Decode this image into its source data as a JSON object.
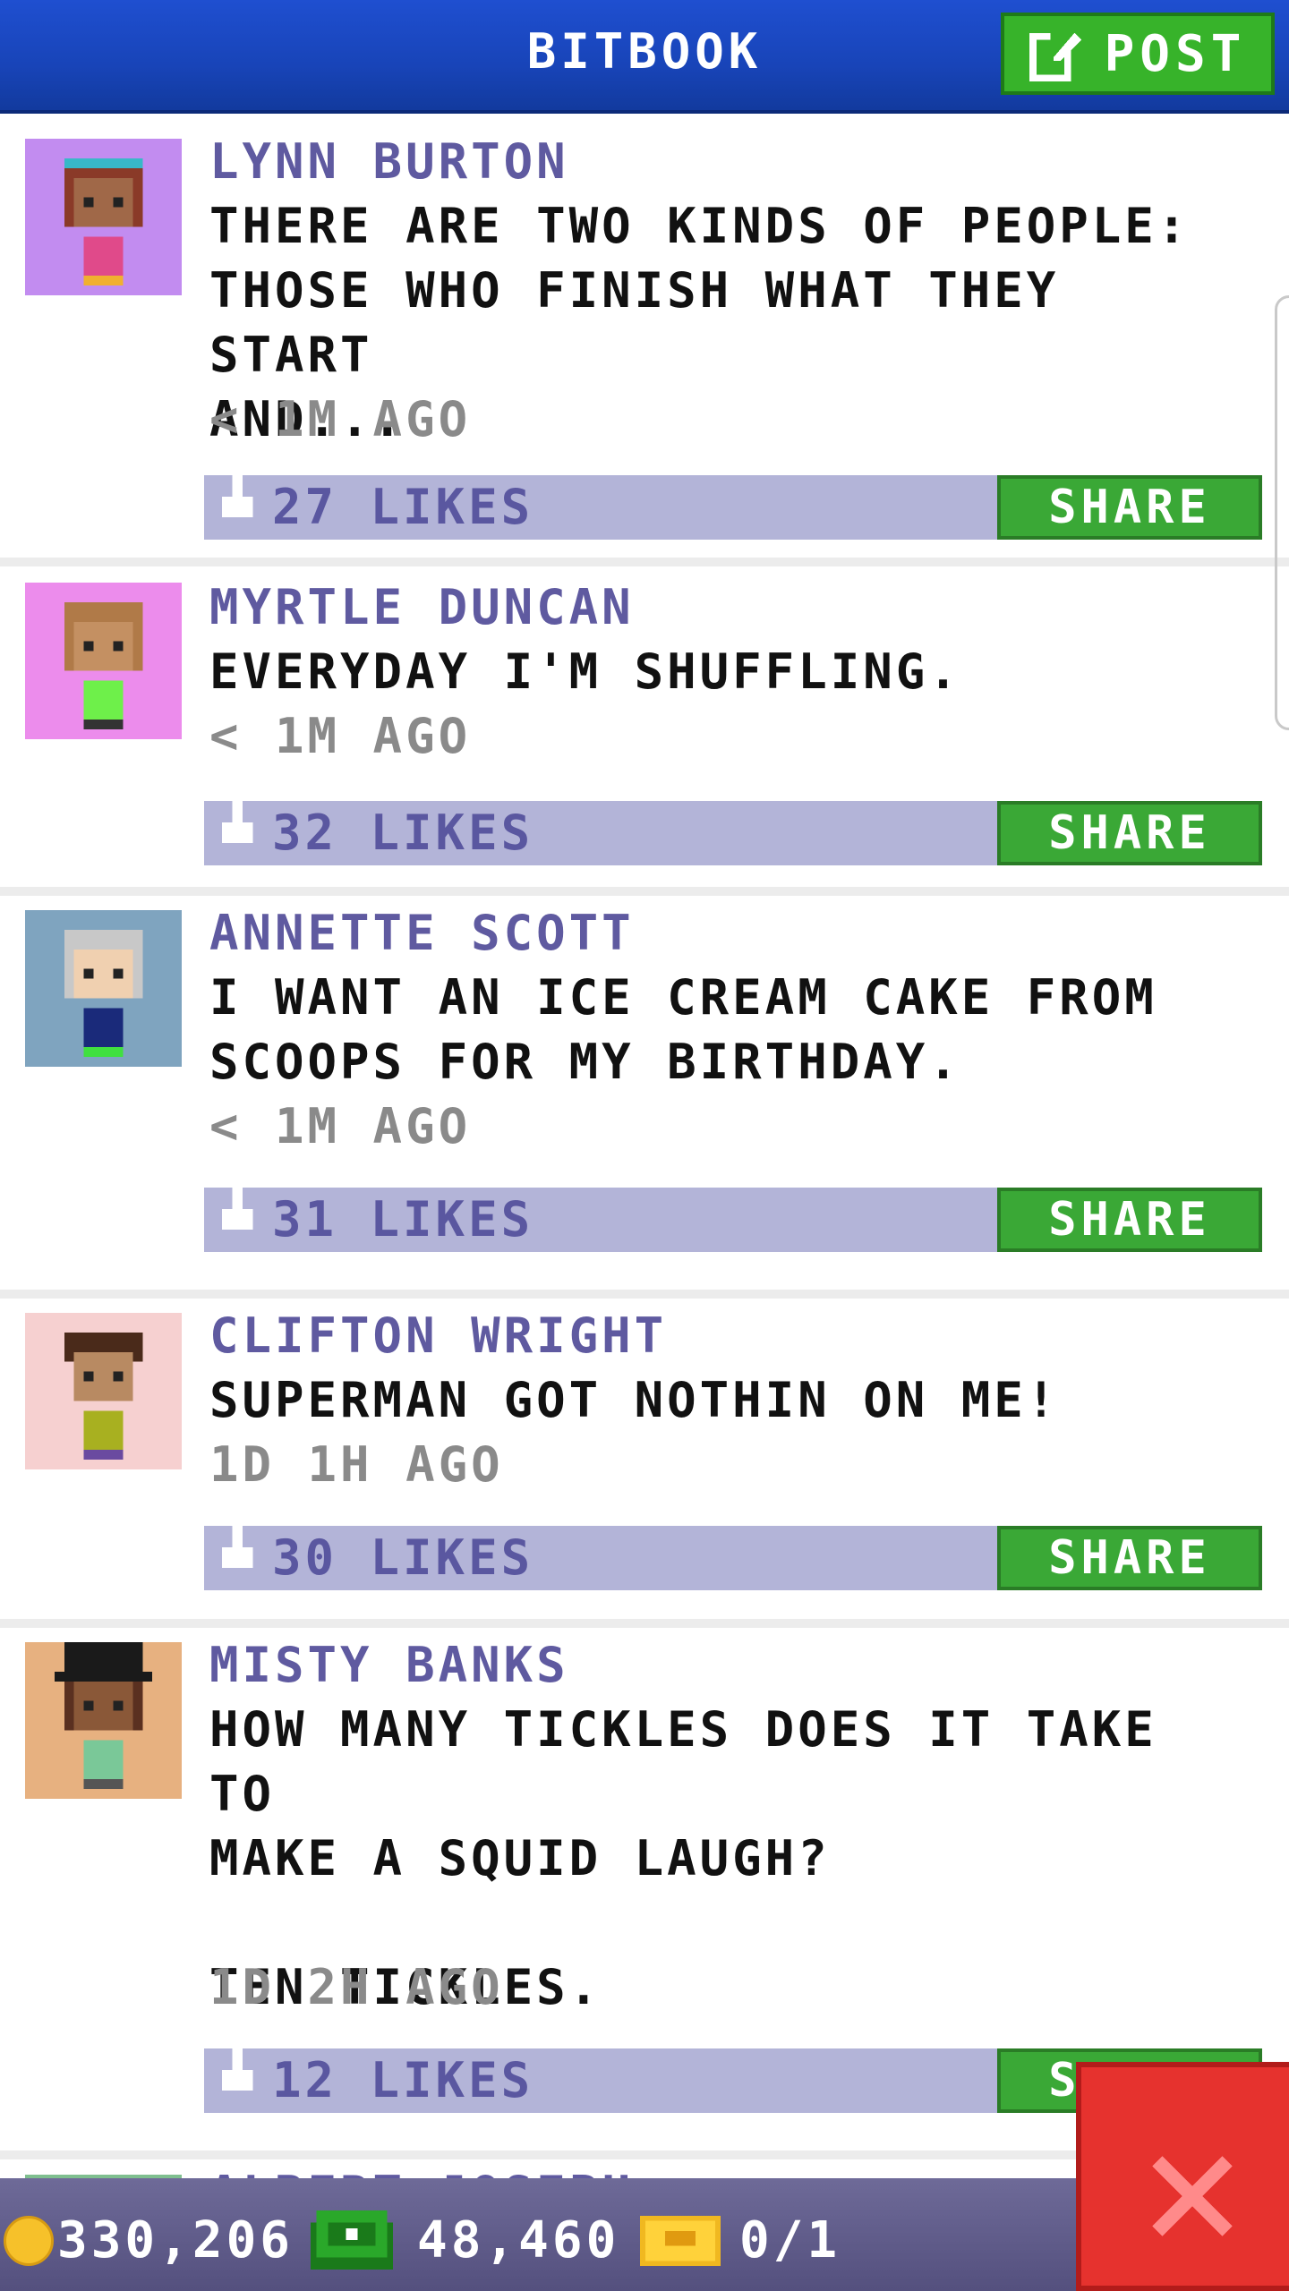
{
  "header": {
    "title": "BITBOOK",
    "post_label": "POST",
    "post_icon": "edit-icon"
  },
  "posts": [
    {
      "name": "LYNN BURTON",
      "message": "THERE ARE TWO KINDS OF PEOPLE:\nTHOSE WHO FINISH WHAT THEY START\nAND...",
      "time": "< 1M AGO",
      "likes": "27 LIKES",
      "share": "SHARE",
      "avatar_bg": "#c28cf0"
    },
    {
      "name": "MYRTLE DUNCAN",
      "message": "EVERYDAY I'M SHUFFLING.",
      "time": "< 1M AGO",
      "likes": "32 LIKES",
      "share": "SHARE",
      "avatar_bg": "#ec8cec"
    },
    {
      "name": "ANNETTE SCOTT",
      "message": "I WANT AN ICE CREAM CAKE FROM\nSCOOPS FOR MY BIRTHDAY.",
      "time": "< 1M AGO",
      "likes": "31 LIKES",
      "share": "SHARE",
      "avatar_bg": "#7fa4bf"
    },
    {
      "name": "CLIFTON WRIGHT",
      "message": "SUPERMAN GOT NOTHIN ON ME!",
      "time": "1D 1H AGO",
      "likes": "30 LIKES",
      "share": "SHARE",
      "avatar_bg": "#f6d0d0"
    },
    {
      "name": "MISTY BANKS",
      "message": "HOW MANY TICKLES DOES IT TAKE TO\nMAKE A SQUID LAUGH?\n\nTEN TICKLES.",
      "time": "1D 2H AGO",
      "likes": "12 LIKES",
      "share": "SHARE",
      "avatar_bg": "#e7b180"
    }
  ],
  "peek_post": {
    "name": "ALBERT JOSEPH"
  },
  "footer": {
    "coins": "330,206",
    "bux": "48,460",
    "tickets": "0/1"
  },
  "colors": {
    "header_blue": "#1844b8",
    "share_green": "#3aa836",
    "like_bar": "#b3b4d8",
    "name_purple": "#5f5aa0",
    "close_red": "#e6322e"
  }
}
